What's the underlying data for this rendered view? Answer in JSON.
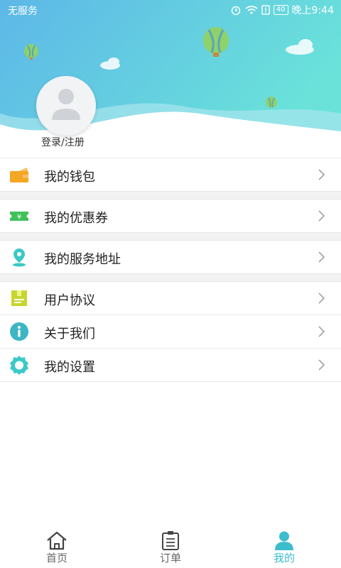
{
  "status_bar": {
    "carrier": "无服务",
    "battery": "40",
    "time": "晚上9:44"
  },
  "profile": {
    "login_label": "登录/注册"
  },
  "menu": [
    {
      "label": "我的钱包",
      "icon": "wallet-icon",
      "color": "#f5a623"
    },
    {
      "label": "我的优惠券",
      "icon": "coupon-icon",
      "color": "#3fc15a"
    },
    {
      "label": "我的服务地址",
      "icon": "location-pin-icon",
      "color": "#3cc8c8"
    },
    {
      "label": "用户协议",
      "icon": "agreement-icon",
      "color": "#c7d62e"
    },
    {
      "label": "关于我们",
      "icon": "info-icon",
      "color": "#3cb6c4"
    },
    {
      "label": "我的设置",
      "icon": "gear-icon",
      "color": "#3cc8c8"
    }
  ],
  "tabbar": {
    "items": [
      {
        "label": "首页",
        "icon": "home-icon"
      },
      {
        "label": "订单",
        "icon": "order-icon"
      },
      {
        "label": "我的",
        "icon": "user-icon",
        "active": true
      }
    ],
    "active_color": "#3cbdcc"
  },
  "colors": {
    "header_gradient_start": "#5fb8e6",
    "header_gradient_end": "#68e0dc"
  }
}
